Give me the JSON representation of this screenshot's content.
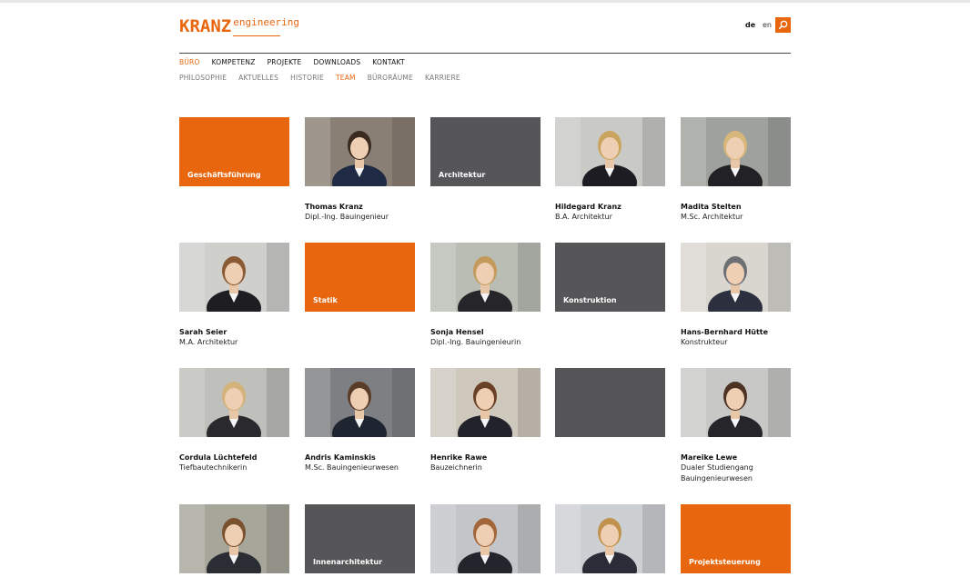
{
  "brand": {
    "name": "KRANZ",
    "suffix": "engineering",
    "accent": "#e8670e",
    "tile_gray": "#565659"
  },
  "header": {
    "lang_de": "de",
    "lang_en": "en",
    "search_icon": "search-icon"
  },
  "nav": {
    "primary": [
      "BÜRO",
      "KOMPETENZ",
      "PROJEKTE",
      "DOWNLOADS",
      "KONTAKT"
    ],
    "primary_active": "BÜRO",
    "secondary": [
      "PHILOSOPHIE",
      "AKTUELLES",
      "HISTORIE",
      "TEAM",
      "BÜRORÄUME",
      "KARRIERE"
    ],
    "secondary_active": "TEAM"
  },
  "team": {
    "row1": [
      {
        "type": "category",
        "label": "Geschäftsführung",
        "color": "orange"
      },
      {
        "type": "person",
        "name": "Thomas Kranz",
        "role": "Dipl.-Ing. Bauingenieur"
      },
      {
        "type": "category",
        "label": "Architektur",
        "color": "dark"
      },
      {
        "type": "person",
        "name": "Hildegard Kranz",
        "role": "B.A. Architektur"
      },
      {
        "type": "person",
        "name": "Madita Stelten",
        "role": "M.Sc. Architektur"
      }
    ],
    "row2": [
      {
        "type": "person",
        "name": "Sarah Seier",
        "role": "M.A. Architektur"
      },
      {
        "type": "category",
        "label": "Statik",
        "color": "orange"
      },
      {
        "type": "person",
        "name": "Sonja Hensel",
        "role": "Dipl.-Ing. Bauingenieurin"
      },
      {
        "type": "category",
        "label": "Konstruktion",
        "color": "dark"
      },
      {
        "type": "person",
        "name": "Hans-Bernhard Hütte",
        "role": "Konstrukteur"
      }
    ],
    "row3": [
      {
        "type": "person",
        "name": "Cordula Lüchtefeld",
        "role": "Tiefbautechnikerin"
      },
      {
        "type": "person",
        "name": "Andris Kaminskis",
        "role": "M.Sc. Bauingenieurwesen"
      },
      {
        "type": "person",
        "name": "Henrike Rawe",
        "role": "Bauzeichnerin"
      },
      {
        "type": "category",
        "label": "",
        "color": "dark"
      },
      {
        "type": "person",
        "name": "Mareike Lewe",
        "role": "Dualer Studiengang",
        "role2": "Bauingenieurwesen"
      }
    ],
    "row4": [
      {
        "type": "person",
        "name": "",
        "role": ""
      },
      {
        "type": "category",
        "label": "Innenarchitektur",
        "color": "dark"
      },
      {
        "type": "person",
        "name": "",
        "role": ""
      },
      {
        "type": "person",
        "name": "",
        "role": ""
      },
      {
        "type": "category",
        "label": "Projektsteuerung",
        "color": "orange"
      }
    ]
  }
}
